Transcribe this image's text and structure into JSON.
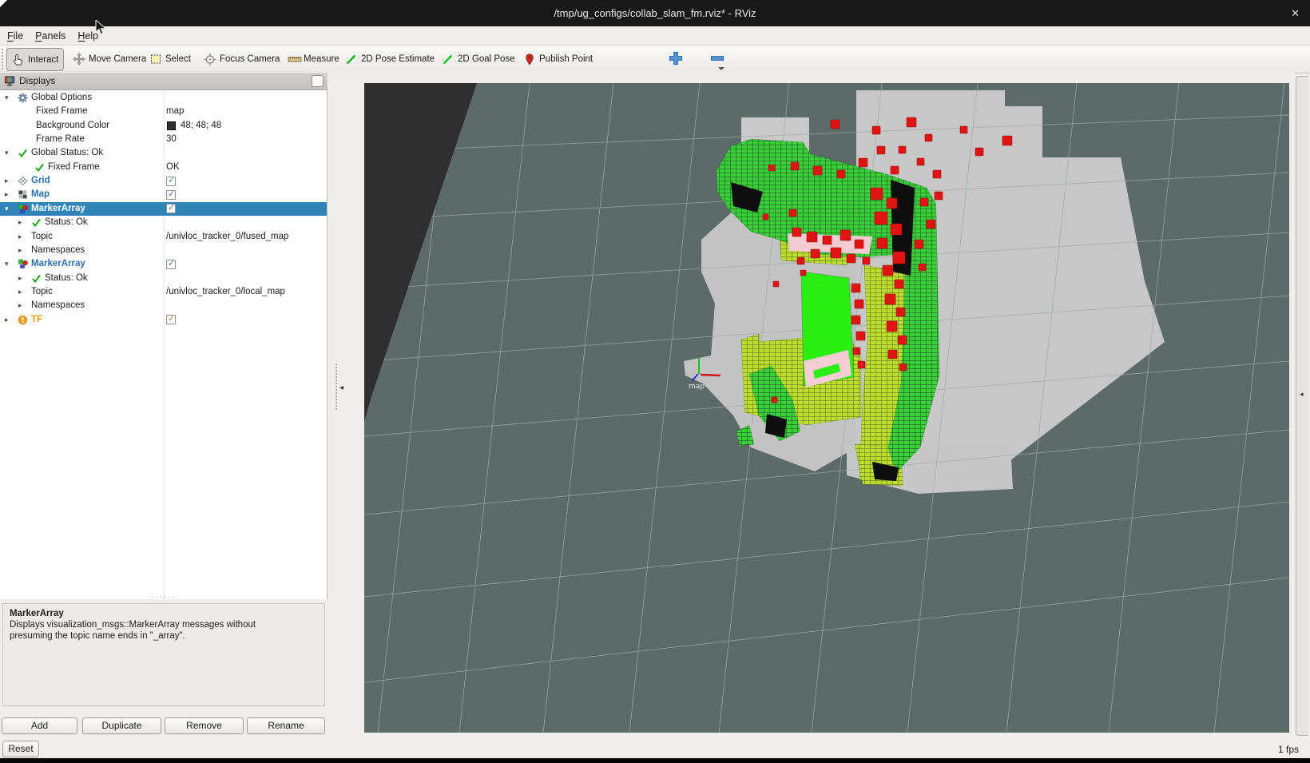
{
  "window": {
    "title": "/tmp/ug_configs/collab_slam_fm.rviz* - RViz",
    "close_glyph": "✕"
  },
  "menu": {
    "items": [
      "File",
      "Panels",
      "Help"
    ]
  },
  "toolbar": {
    "tools": [
      {
        "label": "Interact",
        "icon": "interact",
        "active": true
      },
      {
        "label": "Move Camera",
        "icon": "move-camera"
      },
      {
        "label": "Select",
        "icon": "select"
      },
      {
        "label": "Focus Camera",
        "icon": "focus-camera"
      },
      {
        "label": "Measure",
        "icon": "measure"
      },
      {
        "label": "2D Pose Estimate",
        "icon": "pose-estimate"
      },
      {
        "label": "2D Goal Pose",
        "icon": "goal-pose"
      },
      {
        "label": "Publish Point",
        "icon": "publish-point"
      }
    ],
    "add_tool_glyph": "+",
    "remove_tool_glyph": "−"
  },
  "displays_panel": {
    "title": "Displays",
    "splitter_dots": "······",
    "tree": [
      {
        "ind": 0,
        "e": "d",
        "icon": "gear",
        "label": "Global Options"
      },
      {
        "ind": 1,
        "label": "Fixed Frame",
        "val": {
          "t": "text",
          "text": "map"
        }
      },
      {
        "ind": 1,
        "label": "Background Color",
        "val": {
          "t": "swatch",
          "text": "48; 48; 48",
          "hex": "#303030"
        }
      },
      {
        "ind": 1,
        "label": "Frame Rate",
        "val": {
          "t": "text",
          "text": "30"
        }
      },
      {
        "ind": 0,
        "e": "d",
        "icon": "check",
        "label": "Global Status: Ok"
      },
      {
        "ind": 1,
        "icon": "check",
        "label": "Fixed Frame",
        "val": {
          "t": "text",
          "text": "OK"
        }
      },
      {
        "ind": 0,
        "e": "r",
        "icon": "grid",
        "label": "Grid",
        "style": "display",
        "val": {
          "t": "check",
          "color": "blue"
        }
      },
      {
        "ind": 0,
        "e": "r",
        "icon": "map",
        "label": "Map",
        "style": "display",
        "val": {
          "t": "check",
          "color": "blue"
        }
      },
      {
        "ind": 0,
        "e": "d",
        "icon": "marker",
        "label": "MarkerArray",
        "style": "display",
        "sel": true,
        "val": {
          "t": "check",
          "color": "blue"
        }
      },
      {
        "ind": 1,
        "e": "r",
        "icon": "check",
        "label": "Status: Ok"
      },
      {
        "ind": 1,
        "e": "r",
        "label": "Topic",
        "val": {
          "t": "text",
          "text": "/univloc_tracker_0/fused_map"
        }
      },
      {
        "ind": 1,
        "e": "r",
        "label": "Namespaces"
      },
      {
        "ind": 0,
        "e": "d",
        "icon": "marker",
        "label": "MarkerArray",
        "style": "display",
        "val": {
          "t": "check",
          "color": "blue"
        }
      },
      {
        "ind": 1,
        "e": "r",
        "icon": "check",
        "label": "Status: Ok"
      },
      {
        "ind": 1,
        "e": "r",
        "label": "Topic",
        "val": {
          "t": "text",
          "text": "/univloc_tracker_0/local_map"
        }
      },
      {
        "ind": 1,
        "e": "r",
        "label": "Namespaces"
      },
      {
        "ind": 0,
        "e": "r",
        "icon": "warn",
        "label": "TF",
        "style": "warn",
        "val": {
          "t": "check",
          "color": "orange"
        }
      }
    ],
    "description": {
      "title": "MarkerArray",
      "body": "Displays visualization_msgs::MarkerArray messages without presuming the topic name ends in \"_array\"."
    },
    "buttons": [
      "Add",
      "Duplicate",
      "Remove",
      "Rename"
    ]
  },
  "status_bar": {
    "reset_label": "Reset",
    "fps": "1 fps"
  },
  "scene": {
    "frame_label": "map"
  },
  "colors": {
    "selection_blue": "#3084b8",
    "display_name_blue": "#2a6fae",
    "warn_orange": "#de9b00",
    "scene_background": "#5c6b67",
    "offmap_background_value": "48; 48; 48",
    "map_gray": "#c6c6c6",
    "marker_green": "#3ccf3c",
    "marker_yellow": "#bcdc32",
    "marker_red": "#e11313",
    "wall_green": "#2bef12",
    "pink": "#f4cbd0"
  }
}
